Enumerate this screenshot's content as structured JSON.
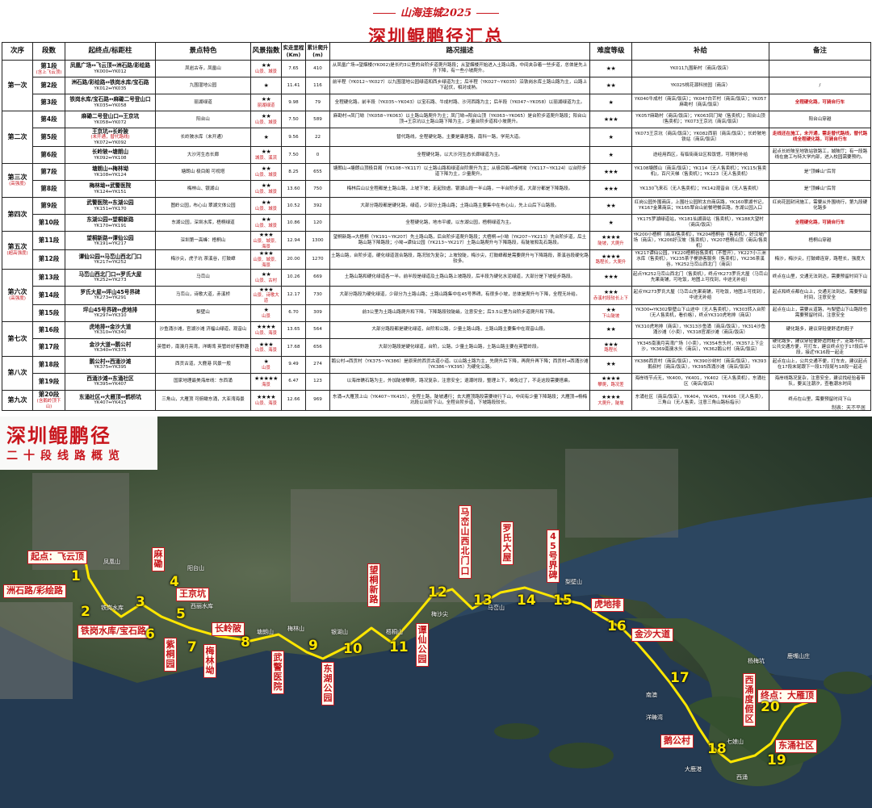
{
  "header": {
    "series_tag": "山海连城2025",
    "title": "深圳鲲鹏径汇总",
    "columns": [
      "次序",
      "段数",
      "起终点/标距柱",
      "景点特色",
      "风景指数",
      "实走里程(Km)",
      "累计爬升(m)",
      "路况描述",
      "难度等级",
      "补给",
      "备注"
    ]
  },
  "rows": [
    {
      "trip": "第一次",
      "trip_sub": "",
      "seg": "第1段",
      "seg_sub": "(含上飞云顶)",
      "route": "凤凰广场↔飞云顶↔洲石路/彩绘路",
      "route_alt": "",
      "code": "YK000↔YK012",
      "scenery": "凤岩古寺，凤凰山",
      "stars": "★★",
      "tags": "山景、城景",
      "km": "7.65",
      "climb": "410",
      "desc": "从凤凰广场→望烟楼(YK002)是长约3公里的台阶步道爬升路段；从望烟楼开始进入土路山路，中间夹杂着一些步道，总体是先上升下降，有一些小坡爬升。",
      "diff": "★★",
      "diff_tag": "",
      "supply": "YK011九围新村（商店/饭店）",
      "note": ""
    },
    {
      "trip": "",
      "trip_sub": "",
      "seg": "第2段",
      "seg_sub": "",
      "route": "洲石路/彩绘路↔铁岗水库/宝石路",
      "route_alt": "",
      "code": "YK012↔YK035",
      "scenery": "九围湿地公园",
      "stars": "★",
      "tags": "",
      "km": "11.41",
      "climb": "116",
      "desc": "前半程（YK012~YK027）以九围湿地公园绿道和西乡绿道为主；后半程（YK027~YK035）沿铁岗水库土路山路为主，山路上下起伏，相对成熟。",
      "diff": "★★",
      "diff_tag": "",
      "supply": "YK025桃花源科技园（商店）",
      "note": "/"
    },
    {
      "trip": "",
      "trip_sub": "",
      "seg": "第3段",
      "seg_sub": "",
      "route": "铁岗水库/宝石路↔麻磡二号登山口",
      "route_alt": "",
      "code": "YK035↔YK058",
      "scenery": "丽湖绿道",
      "stars": "★★",
      "tags": "丽湖绿道",
      "km": "9.98",
      "climb": "79",
      "desc": "全程硬化路。前半段（YK035~YK043）以宝石路、牛成村路、沙河西路为主；后半段（YK047~YK058）以丽湖绿道为主。",
      "diff": "★",
      "diff_tag": "",
      "supply": "YK040牛成村（商店/饭店）；YK047白芒村（商店/饭店）；YK057麻勘村（商店/饭店）",
      "note": "全程硬化路，可骑自行车"
    },
    {
      "trip": "第二次",
      "trip_sub": "",
      "seg": "第4段",
      "seg_sub": "",
      "route": "麻磡二号登山口↔王京坑",
      "route_alt": "",
      "code": "YK058↔YK072",
      "scenery": "阳台山",
      "stars": "★★",
      "tags": "山景、城景",
      "km": "7.50",
      "climb": "589",
      "desc": "麻勘村→凤门坳（YK058~YK063）以土路山路爬升为主；凤门坳→阳台山顶（YK063~YK065）是台阶步道爬升路段；阳台山顶→王京坑以土路山路下降为主，少量台阶步道和小坡爬升。",
      "diff": "★★★",
      "diff_tag": "",
      "supply": "YK057麻勘村（商店/饭店）；YK063凤门坳（售卖机）；阳台山顶（售卖机）；YK073王京坑（商店/饭店）",
      "note": "阳台山穿越"
    },
    {
      "trip": "",
      "trip_sub": "",
      "seg": "第5段",
      "seg_sub": "",
      "route": "王京坑↔长岭陂",
      "route_alt": "(未开通，替代路线)",
      "code": "YK072↔YK092",
      "scenery": "长岭陂水库（未开通）",
      "stars": "★",
      "tags": "",
      "km": "9.56",
      "climb": "22",
      "desc": "替代路线，全程硬化路，主要是康居路，南科一路，学苑大道。",
      "diff": "★",
      "diff_tag": "",
      "supply": "YK073王京坑（商店/饭店）；YK082西丽（商店/饭店）；长岭陂地铁站（商店/饭店）",
      "note": "走线还在施工，未开通，需走替代路线，替代路线全程硬化路，可骑自行车"
    },
    {
      "trip": "",
      "trip_sub": "",
      "seg": "第6段",
      "seg_sub": "",
      "route": "长岭陂↔塘朗山",
      "route_alt": "",
      "code": "YK092↔YK108",
      "scenery": "大沙河生态长廊",
      "stars": "★★",
      "tags": "城景、溪流",
      "km": "7.50",
      "climb": "0",
      "desc": "全程硬化路，以大沙河生态长廊绿道为主。",
      "diff": "★",
      "diff_tag": "",
      "supply": "途经用西区，有临街商业区和饭馆，可随时补给",
      "note": "起点长岭陂至地铁站铁路工，城陂厅；有一段路线在施工与特大学内部，进入校园需要预约。"
    },
    {
      "trip": "第三次",
      "trip_sub": "(高强度)",
      "seg": "第7段",
      "seg_sub": "",
      "route": "塘朗山↔梅林坳",
      "route_alt": "",
      "code": "YK108↔YK124",
      "scenery": "塘朗山 极目阁 可视塔",
      "stars": "★★",
      "tags": "山景、城景",
      "km": "8.25",
      "climb": "655",
      "desc": "塘朗山→塘朗山顶极目阁（YK108~YK117）以土路山路和绿道台阶爬升为主；从极目阁→梅林坳（YK117~YK124）以台阶步道下降为主，少量爬升。",
      "diff": "★★★",
      "diff_tag": "",
      "supply": "YK108塘朗山（商店/饭店）；YK114（无人售卖机）；YK115(售卖机)，百尺天梯（售卖机）；YK123（无人售卖机）",
      "note": "是“顶峰山”后背"
    },
    {
      "trip": "",
      "trip_sub": "",
      "seg": "第8段",
      "seg_sub": "",
      "route": "梅林坳↔武警医院",
      "route_alt": "",
      "code": "YK124↔YK151",
      "scenery": "梅林山、银湖山",
      "stars": "★★",
      "tags": "山景、城景",
      "km": "13.60",
      "climb": "750",
      "desc": "梅林后山以全程都是土路山路，上坡下坡；走起较虐。银湖山段一半山路，一半台阶步道，大部分都是下降路段。",
      "diff": "★★★",
      "diff_tag": "",
      "supply": "YK130飞来石（无人售卖机）；YK142观音台（无人售卖机）",
      "note": "是“顶峰山”后背"
    },
    {
      "trip": "第四次",
      "trip_sub": "",
      "seg": "第9段",
      "seg_sub": "",
      "route": "武警医院↔东湖公园",
      "route_alt": "",
      "code": "YK151↔YK170",
      "scenery": "图岭公园，布心山 翠湖文体公园",
      "stars": "★★",
      "tags": "山景、城景",
      "km": "10.52",
      "climb": "392",
      "desc": "大部分路段都是硬化路，绿道，少部分土路山路；土路山路主要集中在布心山，先上山后下山路段。",
      "diff": "★★",
      "diff_tag": "",
      "supply": "红岗公园外围商店，上围社公园附太白商店路，YK160翠湖书记，YK167金果商店；YK165翠台山前餐吧餐店路，东湖公园入口",
      "note": "红岗花园封闭施工，需要从外围绕行，第九段硬化路多"
    },
    {
      "trip": "",
      "trip_sub": "",
      "seg": "第10段",
      "seg_sub": "",
      "route": "东湖公园↔望桐新路",
      "route_alt": "",
      "code": "YK170↔YK191",
      "scenery": "东湖公园，深圳水库，梧桐绿道",
      "stars": "★★",
      "tags": "山景、城景",
      "km": "10.86",
      "climb": "120",
      "desc": "全程硬化路，地市平缓，以东湖公园，梧桐绿道为主。",
      "diff": "★",
      "diff_tag": "",
      "supply": "YK175罗湖绿道站，YK181仙湖驿站（售卖机），YK188大望村（商店/饭店）",
      "note": "全程硬化路，可骑自行车"
    },
    {
      "trip": "第五次",
      "trip_sub": "(超高强度)",
      "seg": "第11段",
      "seg_sub": "",
      "route": "望桐新路↔谭仙公园",
      "route_alt": "",
      "code": "YK191↔YK217",
      "scenery": "深圳第一高峰：梧桐山",
      "stars": "★★★",
      "tags": "山景、城景、海景",
      "km": "12.94",
      "climb": "1300",
      "desc": "望桐新路→大梧桐（YK191~YK207）先土路山路，后台阶步道爬升路段；大梧桐→小坳（YK207~YK213）先台阶步道，后土路山路下降路段；小坳→谭仙公园（YK213~YK217）土路山路爬升与下降路段，有陡坡和乱石路段。",
      "diff": "★★★★",
      "diff_tag": "陡坡，大爬升",
      "supply": "YK200小梧桐（商店/售卖机），YK204梧桐谷（售卖机），好汉坡广场（商店），YK206好汉坡（售卖机），YK207梧桐山顶（商店/售卖机）",
      "note": "梧桐山穿越"
    },
    {
      "trip": "",
      "trip_sub": "",
      "seg": "第12段",
      "seg_sub": "",
      "route": "谭仙公园↔马峦山西北门口",
      "route_alt": "",
      "code": "YK217↔YK252",
      "scenery": "梅沙尖，虎子坑 茶溪谷，打鼓嶂",
      "stars": "★★★",
      "tags": "山景、城景、海景",
      "km": "20.00",
      "climb": "1270",
      "desc": "土路山路，台阶步道，硬化绿道混合路段，路况较为复杂；上坡较陡，梅沙尖，打鼓嶂都是需要爬升与下降路段，茶溪谷段硬化路较多。",
      "diff": "★★★★",
      "diff_tag": "路程长，大爬升",
      "supply": "YK217谭仙公园，YK220梧桐谷售卖机（不管开），YK227小三洲水库（售卖机），YK235茶子梗游客服务（售卖机），YK236茶溪谷，YK252马峦山西北门（商店）",
      "note": "梅沙，梅沙尖，打鼓嶂连穿，路程长，强度大"
    },
    {
      "trip": "第六次",
      "trip_sub": "(高强度)",
      "seg": "第13段",
      "seg_sub": "",
      "route": "马峦山西北门口↔罗氏大屋",
      "route_alt": "",
      "code": "YK252↔YK273",
      "scenery": "马峦山",
      "stars": "★★",
      "tags": "山景、古村",
      "km": "10.26",
      "climb": "669",
      "desc": "土路山路和硬化绿道各一半。前半段是绿道及土路山路上坡路段，后半段为硬化水泥绿道，大部分是下坡徒步路段。",
      "diff": "★★★",
      "diff_tag": "",
      "supply": "起点YK252马峦山西北门（售卖机），终点YK273罗氏大屋（马峦山先果商铺，可吃饭，地图上可找到，中途无补给）",
      "note": "终点在山里，交通无法到达，需要预留时间下山"
    },
    {
      "trip": "",
      "trip_sub": "",
      "seg": "第14段",
      "seg_sub": "",
      "route": "罗氏大屋↔坪山45号界碑",
      "route_alt": "",
      "code": "YK273↔YK291",
      "scenery": "马峦山，诗歌大道，赤溪桥",
      "stars": "★★★",
      "tags": "山景、诗歌大道",
      "km": "12.17",
      "climb": "730",
      "desc": "大部分路段为硬化绿道，少部分为土路山路；土路山路集中在45号界碑，有很多小坡，总体是爬升与下降，全程无补给。",
      "diff": "★★★",
      "diff_tag": "赤溪村段较长上下",
      "supply": "起点YK273罗氏大屋（马峦山先果商铺，可吃饭，地图上可找到），中途无补给",
      "note": "起点和终点都在山上，交通无法到达，需要预留时间，注意安全"
    },
    {
      "trip": "",
      "trip_sub": "",
      "seg": "第15段",
      "seg_sub": "",
      "route": "坪山45号界碑↔虎地排",
      "route_alt": "",
      "code": "YK297↔YK310",
      "scenery": "梨壁山",
      "stars": "★",
      "tags": "山景",
      "km": "6.70",
      "climb": "309",
      "desc": "前3公里为土路山路爬升和下降，下降路段较陡峭，注意安全；后3.5公里为台阶步道爬升和下降。",
      "diff": "★★",
      "diff_tag": "下山陡坡",
      "supply": "YK300↔YK302梨壁山下山途中（无人售卖机），YK303转入台阶（无人售卖机，看价格），终点YK310虎地排（商店）",
      "note": "起点在山上，需要从道路，与梨壁山下山路段也需要预留时间，注意安全"
    },
    {
      "trip": "第七次",
      "trip_sub": "",
      "seg": "第16段",
      "seg_sub": "",
      "route": "虎地排↔金沙大道",
      "route_alt": "",
      "code": "YK310↔YK340",
      "scenery": "沙鱼涌沙滩，官湖沙滩 济福山绿道，观音山",
      "stars": "★★★★",
      "tags": "山景、海景",
      "km": "13.65",
      "climb": "564",
      "desc": "大部分路段都是硬化绿道，台阶和公路，少量土路山路，土路山路主要集中在观音山段。",
      "diff": "★★",
      "diff_tag": "",
      "supply": "YK310虎地排（商店），YK313沙鱼涌（商店/饭店），YK314沙鱼涌沙滩（小卖），YK318官湖沙滩（商店/饭店）",
      "note": "硬化路多，建议穿轻便舒适的鞋子"
    },
    {
      "trip": "",
      "trip_sub": "",
      "seg": "第17段",
      "seg_sub": "",
      "route": "金沙大道↔鹅公村",
      "route_alt": "",
      "code": "YK340↔YK375",
      "scenery": "英管岭，南澳月亮湾，洋畴湾 英管岭好客野趣",
      "stars": "★★★",
      "tags": "山景、海景",
      "km": "17.68",
      "climb": "656",
      "desc": "大部分路段是硬化绿道，台阶，公路，少量土路山路，土路山路主要在英管岭段。",
      "diff": "★★★",
      "diff_tag": "路程长",
      "supply": "YK345南澳月亮湾广场（小卖），YK354东头村，YK357上下企沙，YK369南澳水头（商店），YK362鹅公村（商店/饭店）",
      "note": "硬化路多，建议穿轻便舒适的鞋子，走路不同，公共交通方便，可打车，建议终点位于17段后半段，接近YK16段一起走"
    },
    {
      "trip": "第八次",
      "trip_sub": "",
      "seg": "第18段",
      "seg_sub": "",
      "route": "鹅公村↔西涌沙滩",
      "route_alt": "",
      "code": "YK375↔YK395",
      "scenery": "西贡古道，大鹿港 风景一般",
      "stars": "★",
      "tags": "山景",
      "km": "9.49",
      "climb": "274",
      "desc": "鹅公村→西贡村（YK375~YK386）是原来的西贡古道小道。以山路土路为主，先爬升后下降，再爬升再下降；西贡村→西涌沙滩（YK386~YK395）为硬化公路。",
      "diff": "★★",
      "diff_tag": "",
      "supply": "YK386西贡村（商店/饭店），YK390沙树村（商店/饭店），YK393鹅叔村（商店/饭店），YK395西涌沙滩（商店/饭店）",
      "note": "起点在山上，公共交通不便，打车去，建议起点在17段末尾跟下一段17段尾与18段一起走"
    },
    {
      "trip": "",
      "trip_sub": "",
      "seg": "第19段",
      "seg_sub": "",
      "route": "西涌沙滩↔东涌社区",
      "route_alt": "",
      "code": "YK395↔YK407",
      "scenery": "国家地理最美海岸线：东西涌",
      "stars": "★★★★★",
      "tags": "海景",
      "km": "6.47",
      "climb": "123",
      "desc": "以海岸礁石路为主，外加陡坡攀爬，路况复杂，注意安全；退潮时段，整理上下，难免过了，不走这段需要搭乘。",
      "diff": "★★★★",
      "diff_tag": "攀爬，路况差",
      "supply": "海岸线节点无，YK400，YK401，YK402（无人售卖机），东涌社区（商店/饭店）",
      "note": "海岸线路况复杂，注意安全，建议找经验者带队，要关注潮汐，查看潮水时间"
    },
    {
      "trip": "第九次",
      "trip_sub": "",
      "seg": "第20段",
      "seg_sub": "(含鹅岭顶下山)",
      "route": "东涌社区↔大雁顶↔鹤桥坑",
      "route_alt": "",
      "code": "YK407↔YK415",
      "scenery": "三角山，大雁顶 可俯瞰东涌，大亚湾海景",
      "stars": "★★★★",
      "tags": "山景、海景",
      "km": "12.66",
      "climb": "969",
      "desc": "东涌→大雁顶上山（YK407~YK415），全程土路，陡坡通行；去大雁顶路段需要绕行下山，中间有少量下降路段；大雁顶→杨梅坑段以台阶下山，全程台阶步道，下坡路段较长。",
      "diff": "★★★★",
      "diff_tag": "大爬升，陡坡",
      "supply": "东涌社区（商店/饭店），YK404，YK405，YK406（无人售卖），三角山（无人售卖，注意三角山路标指示）",
      "note": "终点在山里，需要预留时间下山"
    }
  ],
  "credit": "制表：天不平居",
  "map": {
    "title": "深圳鲲鹏径",
    "subtitle": "二十段线路概览",
    "start_label": "起点：飞云顶",
    "end_label": "终点：大雁顶",
    "labels": [
      "洲石路/彩绘路",
      "铁岗水库/宝石路",
      "麻磡",
      "王京坑",
      "长岭陂",
      "紫桐园",
      "塘朗山",
      "梅林坳",
      "武警医院",
      "东湖公园",
      "望桐新路",
      "谭仙公园",
      "马峦山西北门口",
      "罗氏大屋",
      "45号界碑",
      "虎地排",
      "金沙大道",
      "鹅公村",
      "西涌度假区",
      "东涌社区"
    ],
    "places": [
      "凤凰山",
      "阳台山",
      "铁岗水库",
      "西丽水库",
      "塘朗山",
      "梅林山",
      "银湖山",
      "梧桐山",
      "梅沙尖",
      "马峦山",
      "梨壁山",
      "七娘山",
      "杨梅坑",
      "鹿嘴山庄",
      "大鹿港",
      "西涌",
      "南澳",
      "洋畴湾"
    ]
  },
  "colors": {
    "accent": "#c8161d",
    "route": "#ffe600"
  }
}
